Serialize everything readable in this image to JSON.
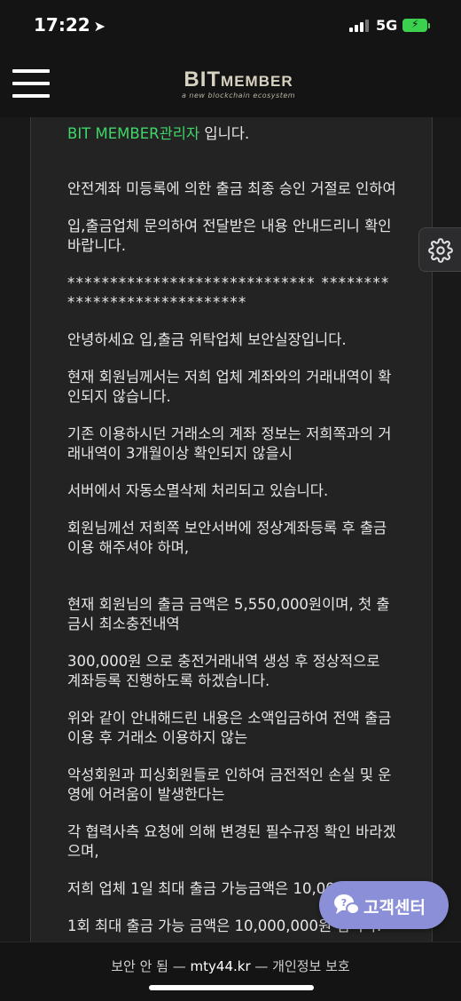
{
  "status": {
    "time": "17:22",
    "network": "5G"
  },
  "header": {
    "logo_bit": "BIT",
    "logo_member": "MEMBER",
    "logo_tagline": "a new blockchain ecosystem"
  },
  "message": {
    "sender_name": "BIT MEMBER관리자",
    "sender_suffix": " 입니다.",
    "lines": [
      "안전계좌 미등록에 의한 출금 최종 승인 거절로 인하여",
      "입,출금업체 문의하여 전달받은 내용 안내드리니 확인바랍니다.",
      "***************************** *****************************",
      "안녕하세요 입,출금 위탁업체 보안실장입니다.",
      "현재 회원님께서는 저희 업체 계좌와의 거래내역이 확인되지 않습니다.",
      "기존 이용하시던 거래소의 계좌 정보는 저희쪽과의 거래내역이 3개월이상 확인되지 않을시",
      "서버에서 자동소멸삭제 처리되고 있습니다.",
      "회원님께선 저희쪽 보안서버에 정상계좌등록 후 출금 이용 해주셔야 하며,",
      "현재 회원님의 출금 금액은 5,550,000원이며, 첫 출금시 최소충전내역",
      "300,000원 으로 충전거래내역 생성 후 정상적으로 계좌등록 진행하도록 하겠습니다.",
      "위와 같이 안내해드린 내용은 소액입금하여 전액 출금 이용 후 거래소 이용하지 않는",
      "악성회원과 피싱회원들로 인하여 금전적인 손실 및 운영에 어려움이 발생한다는",
      "각 협력사측 요청에 의해 변경된 필수규정 확인 바라겠으며,",
      "저희 업체 1일 최대 출금 가능금액은 10,000,000원",
      "1회 최대 출금 가능 금액은 10,000,000원 입니다."
    ]
  },
  "support_button": {
    "label": "고객센터"
  },
  "footer": {
    "prefix": "보안 안 됨 — ",
    "domain": "mty44.kr",
    "suffix": " — 개인정보 보호"
  }
}
